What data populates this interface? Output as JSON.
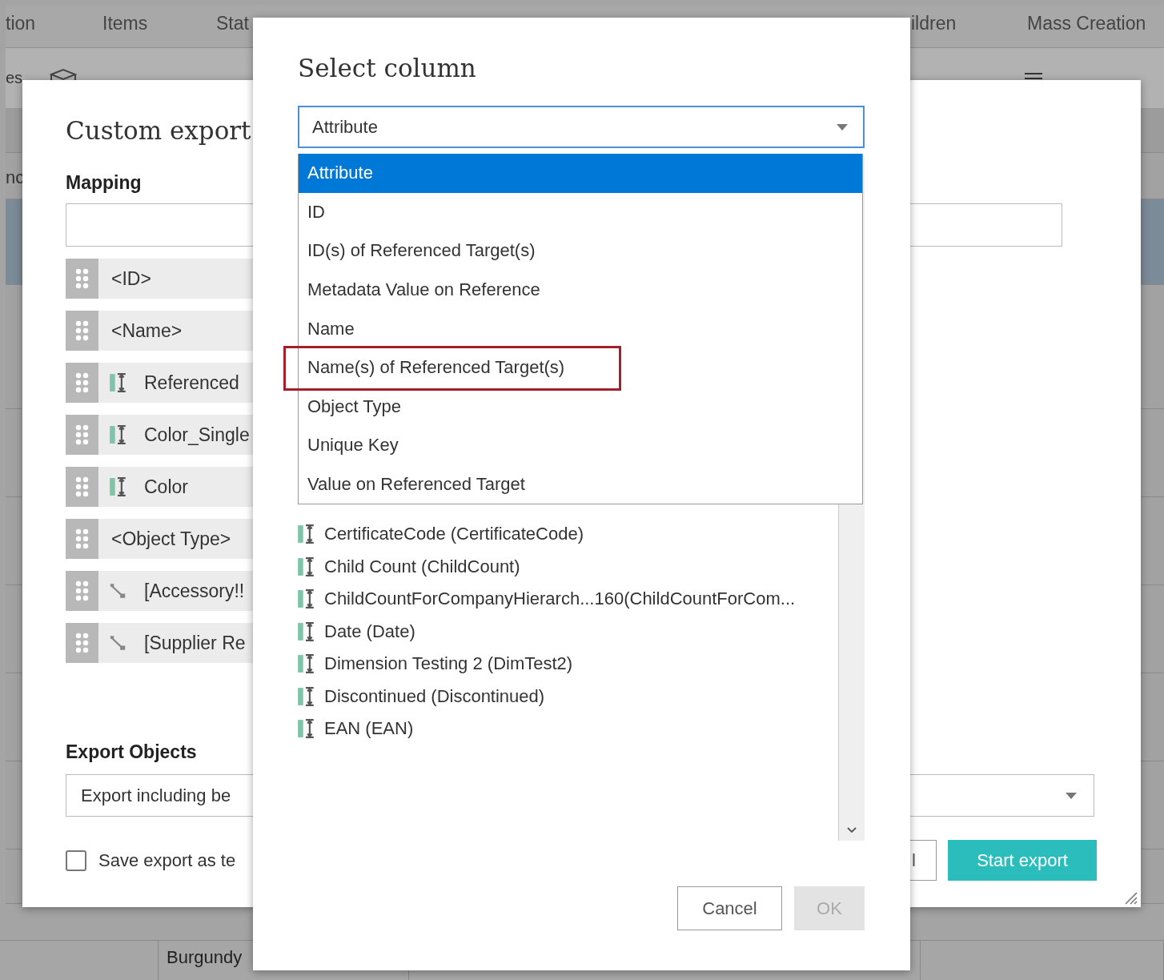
{
  "background": {
    "tabs": [
      "tion",
      "Items",
      "Stat",
      "ildren",
      "Mass Creation"
    ],
    "toolbar": {
      "left_text": "es"
    },
    "row_label": "nc",
    "bottom_cell": "Burgundy"
  },
  "custom_export": {
    "title": "Custom export",
    "mapping_label": "Mapping",
    "mapping_rows": [
      {
        "kind": "plain",
        "label": "<ID>"
      },
      {
        "kind": "plain",
        "label": "<Name>"
      },
      {
        "kind": "attribute",
        "label": "Referenced"
      },
      {
        "kind": "attribute",
        "label": "Color_Single"
      },
      {
        "kind": "attribute",
        "label": "Color"
      },
      {
        "kind": "plain",
        "label": "<Object Type>"
      },
      {
        "kind": "reference",
        "label": "[Accessory!!"
      },
      {
        "kind": "reference",
        "label": "[Supplier Re"
      }
    ],
    "export_objects_label": "Export Objects",
    "export_objects_value": "Export including be",
    "save_template": {
      "label": "Save export as te",
      "checked": false
    },
    "buttons": {
      "cancel_fragment": "l",
      "start": "Start export"
    }
  },
  "select_column": {
    "title": "Select column",
    "select_value": "Attribute",
    "options": [
      {
        "label": "Attribute",
        "selected": true,
        "highlighted": false
      },
      {
        "label": "ID",
        "selected": false,
        "highlighted": false
      },
      {
        "label": "ID(s) of Referenced Target(s)",
        "selected": false,
        "highlighted": false
      },
      {
        "label": "Metadata Value on Reference",
        "selected": false,
        "highlighted": false
      },
      {
        "label": "Name",
        "selected": false,
        "highlighted": false
      },
      {
        "label": "Name(s) of Referenced Target(s)",
        "selected": false,
        "highlighted": true
      },
      {
        "label": "Object Type",
        "selected": false,
        "highlighted": false
      },
      {
        "label": "Unique Key",
        "selected": false,
        "highlighted": false
      },
      {
        "label": "Value on Referenced Target",
        "selected": false,
        "highlighted": false
      }
    ],
    "attributes": [
      "CertificateCode (CertificateCode)",
      "Child Count (ChildCount)",
      "ChildCountForCompanyHierarch...160(ChildCountForCom...",
      "Date (Date)",
      "Dimension Testing 2 (DimTest2)",
      "Discontinued (Discontinued)",
      "EAN (EAN)"
    ],
    "buttons": {
      "cancel": "Cancel",
      "ok": "OK",
      "ok_disabled": true
    }
  }
}
